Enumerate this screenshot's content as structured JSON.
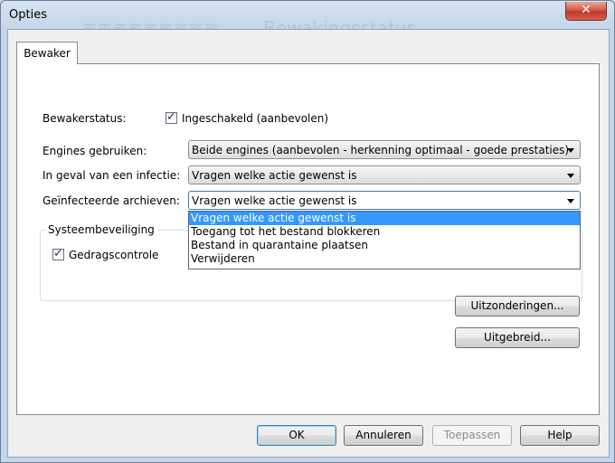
{
  "window": {
    "title": "Opties",
    "close_glyph": "✕",
    "background_text": "Bewakingsstatus"
  },
  "tabs": [
    {
      "label": "Bewaker",
      "selected": true
    }
  ],
  "guard_status": {
    "label": "Bewakerstatus:",
    "checkbox_label": "Ingeschakeld (aanbevolen)",
    "checked": true
  },
  "engines": {
    "label": "Engines gebruiken:",
    "value": "Beide engines (aanbevolen - herkenning optimaal - goede prestaties)"
  },
  "infection": {
    "label": "In geval van een infectie:",
    "value": "Vragen welke actie gewenst is"
  },
  "archives": {
    "label": "Geïnfecteerde archieven:",
    "value": "Vragen welke actie gewenst is",
    "options": [
      "Vragen welke actie gewenst is",
      "Toegang tot het bestand blokkeren",
      "Bestand in quarantaine plaatsen",
      "Verwijderen"
    ],
    "selected_index": 0
  },
  "system_protection": {
    "legend": "Systeembeveiliging",
    "checkbox_label": "Gedragscontrole",
    "checked": true
  },
  "side_buttons": {
    "exceptions": "Uitzonderingen...",
    "advanced": "Uitgebreid..."
  },
  "footer_buttons": {
    "ok": "OK",
    "cancel": "Annuleren",
    "apply": "Toepassen",
    "help": "Help"
  },
  "colors": {
    "highlight": "#3399ff",
    "close_button": "#c0392b",
    "frame": "#c4d6ea"
  }
}
